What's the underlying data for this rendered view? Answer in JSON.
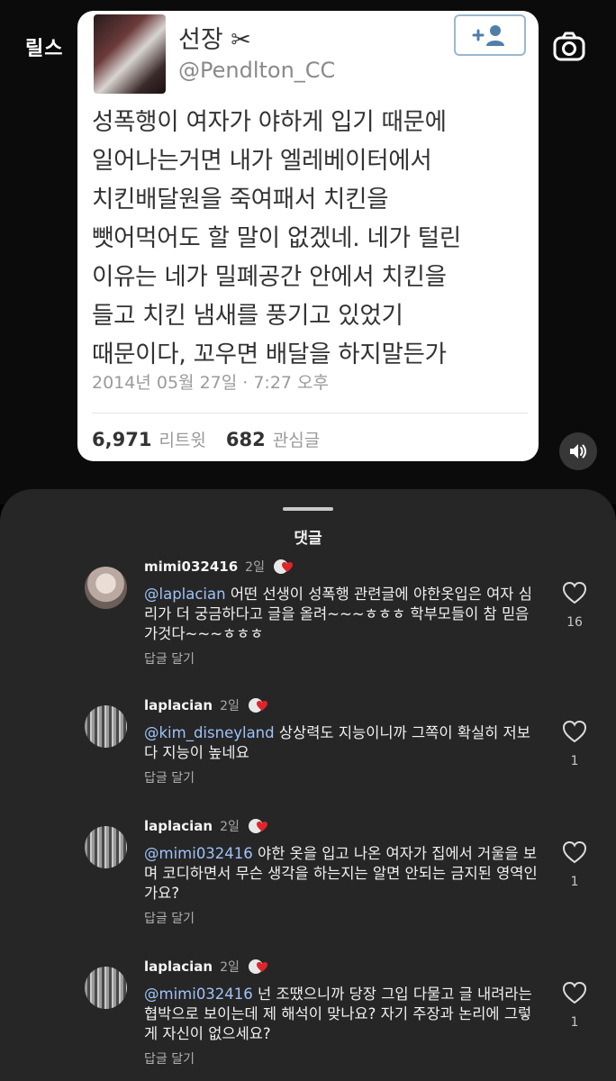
{
  "header": {
    "title": "릴스"
  },
  "tweet": {
    "name": "선장 ✂",
    "handle": "@Pendlton_CC",
    "body": "성폭행이 여자가 야하게 입기 때문에\n일어나는거면 내가 엘레베이터에서\n치킨배달원을 죽여패서 치킨을\n뺏어먹어도 할 말이 없겠네. 네가 털린\n이유는 네가 밀폐공간 안에서 치킨을\n들고 치킨 냄새를 풍기고 있었기\n때문이다, 꼬우면 배달을 하지말든가",
    "date": "2014년 05월 27일 · 7:27 오후",
    "retweets": "6,971",
    "retweets_label": "리트윗",
    "likes": "682",
    "likes_label": "관심글"
  },
  "sheet": {
    "title": "댓글"
  },
  "comments": [
    {
      "user": "mimi032416",
      "time": "2일",
      "mention": "@laplacian",
      "text": " 어떤 선생이  성폭행 관련글에  야한옷입은 여자 심리가 더 궁금하다고 글을 올려~~~ㅎㅎㅎ  학부모들이 참 믿음가것다~~~ㅎㅎㅎ",
      "reply": "답글 달기",
      "likes": "16"
    },
    {
      "user": "laplacian",
      "time": "2일",
      "mention": "@kim_disneyland",
      "text": " 상상력도 지능이니까 그쪽이 확실히 저보다 지능이 높네요",
      "reply": "답글 달기",
      "likes": "1"
    },
    {
      "user": "laplacian",
      "time": "2일",
      "mention": "@mimi032416",
      "text": " 야한 옷을 입고 나온 여자가 집에서 거울을 보며 코디하면서 무슨 생각을 하는지는 알면 안되는 금지된 영역인가요?",
      "reply": "답글 달기",
      "likes": "1"
    },
    {
      "user": "laplacian",
      "time": "2일",
      "mention": "@mimi032416",
      "text": " 넌 조땠으니까 당장 그입 다물고 글 내려라는 협박으로 보이는데 제 해석이 맞나요? 자기 주장과 논리에 그렇게 자신이 없으세요?",
      "reply": "답글 달기",
      "likes": "1"
    }
  ],
  "icons": {
    "camera": "camera-icon",
    "volume": "volume-icon",
    "follow": "add-user-icon",
    "heart": "heart-icon"
  }
}
